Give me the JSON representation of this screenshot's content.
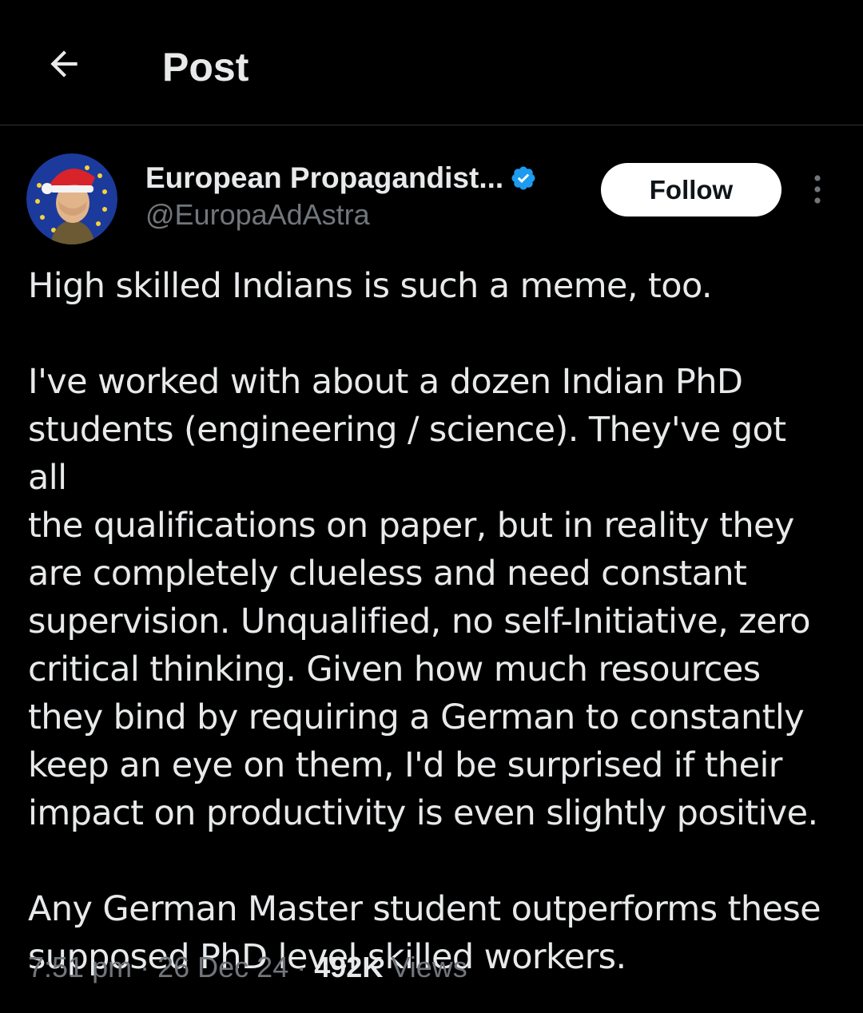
{
  "header": {
    "back_icon": "arrow-left-icon",
    "title": "Post"
  },
  "author": {
    "display_name": "European Propagandist...",
    "handle": "@EuropaAdAstra",
    "verified_icon": "verified-badge-icon",
    "verified_color": "#1d9bf0",
    "avatar_icon": "avatar-portrait-santa-hat-eu-stars"
  },
  "actions": {
    "follow_label": "Follow",
    "more_icon": "more-vertical-icon"
  },
  "post": {
    "paragraphs": [
      "High skilled Indians is such a meme, too.",
      "I've worked with about a dozen Indian PhD\nstudents (engineering / science). They've got all\nthe qualifications on paper, but in reality they\nare completely clueless and need constant\nsupervision. Unqualified, no self-Initiative, zero\ncritical thinking. Given how much resources\nthey bind by requiring a German to constantly\nkeep an eye on them, I'd be surprised if their\nimpact on productivity is even slightly positive.",
      "Any German Master student outperforms these\nsupposed PhD level skilled workers."
    ]
  },
  "meta": {
    "time": "7:51 pm",
    "separator": "·",
    "date": "26 Dec 24",
    "views_count": "492K",
    "views_label": "Views"
  },
  "colors": {
    "background": "#000000",
    "text_primary": "#e7e9ea",
    "text_secondary": "#71767b",
    "divider": "#2f3336",
    "follow_bg": "#ffffff"
  }
}
